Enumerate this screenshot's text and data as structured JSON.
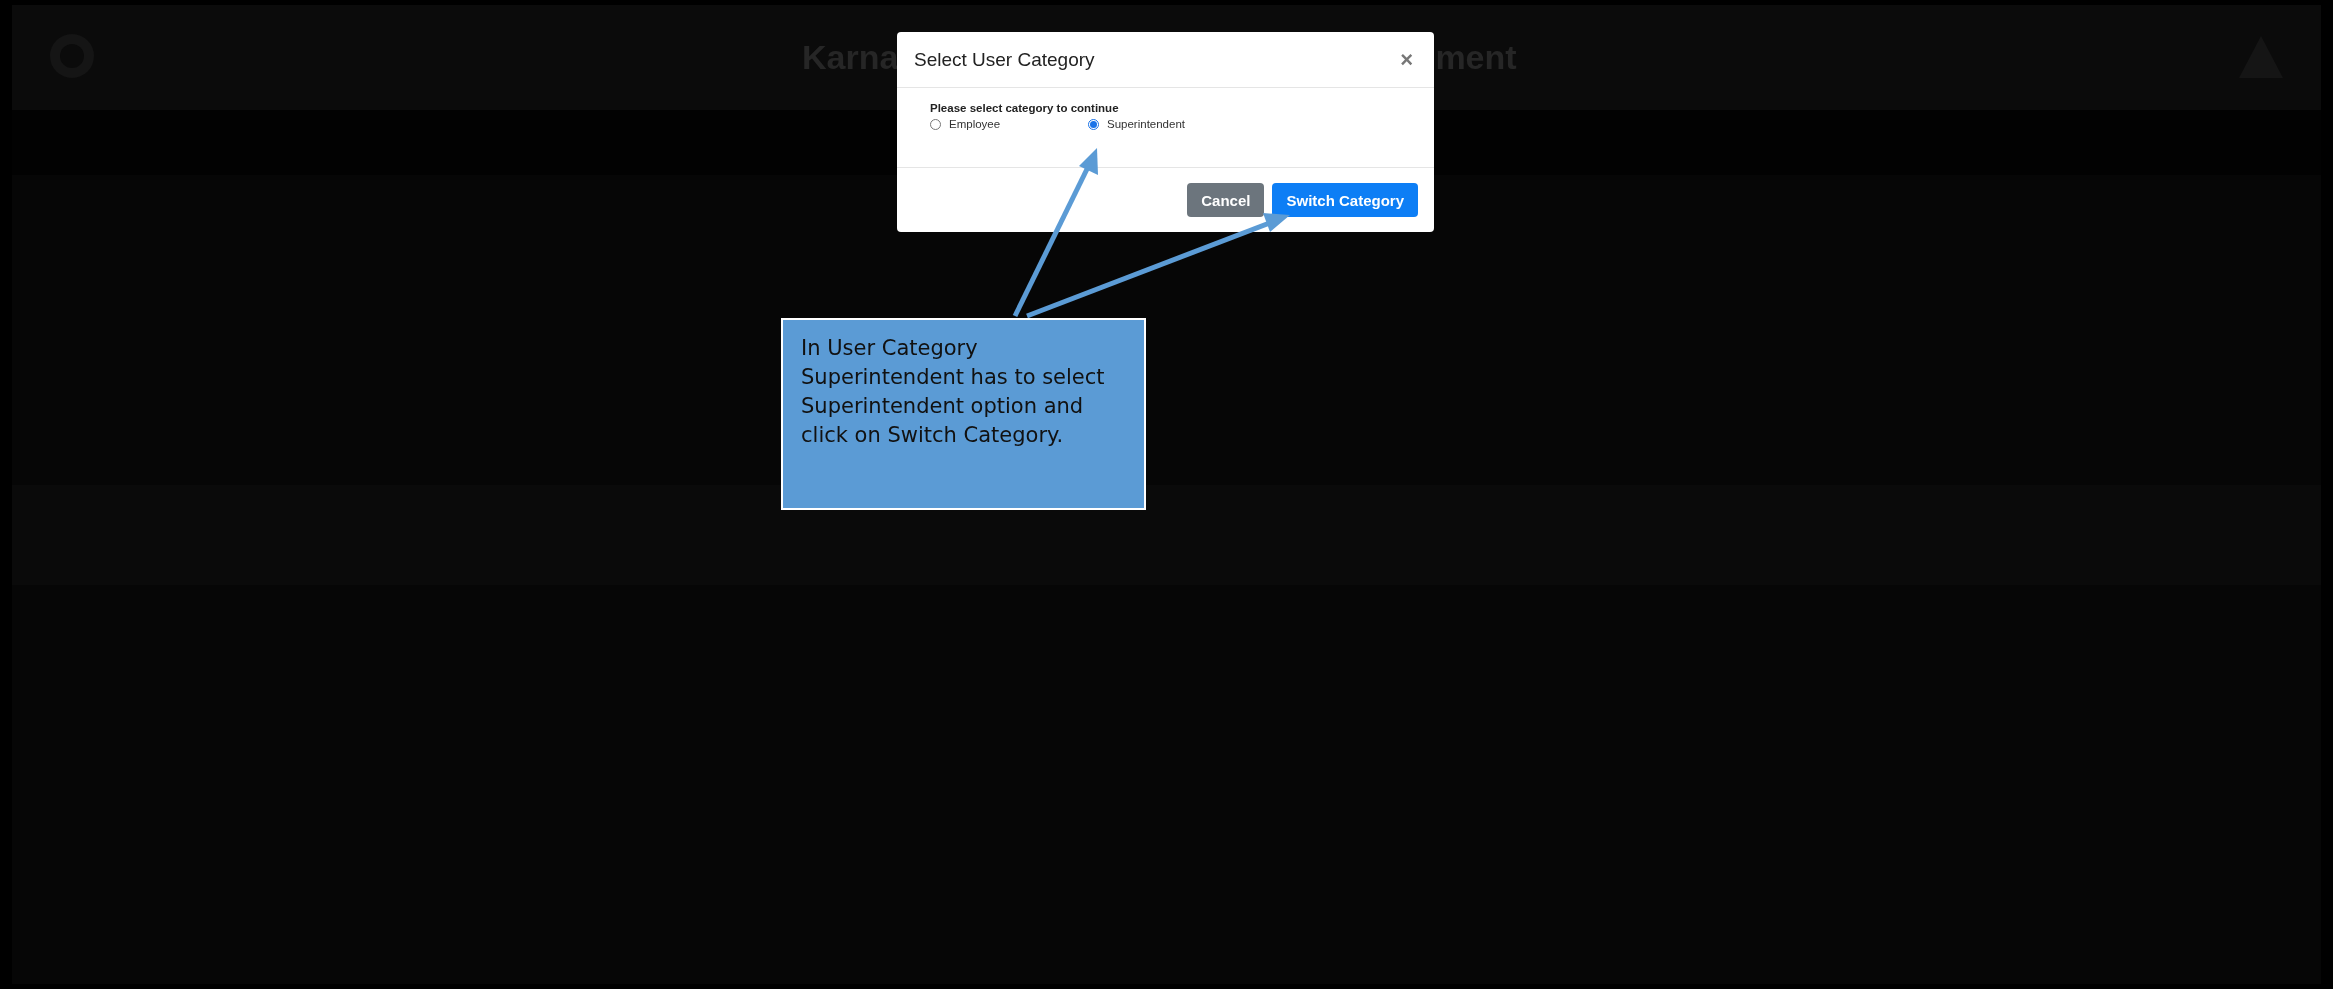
{
  "page": {
    "header_title_start": "Karna",
    "header_title_end": "ment"
  },
  "dialog": {
    "title": "Select User Category",
    "close": "×",
    "prompt": "Please select category to continue",
    "options": [
      {
        "label": "Employee",
        "selected": false
      },
      {
        "label": "Superintendent",
        "selected": true
      }
    ],
    "buttons": [
      {
        "label": "Cancel",
        "kind": "secondary"
      },
      {
        "label": "Switch Category",
        "kind": "primary"
      }
    ]
  },
  "callout": {
    "text": "In User Category Superintendent has to select Superintendent option and click on Switch Category."
  }
}
